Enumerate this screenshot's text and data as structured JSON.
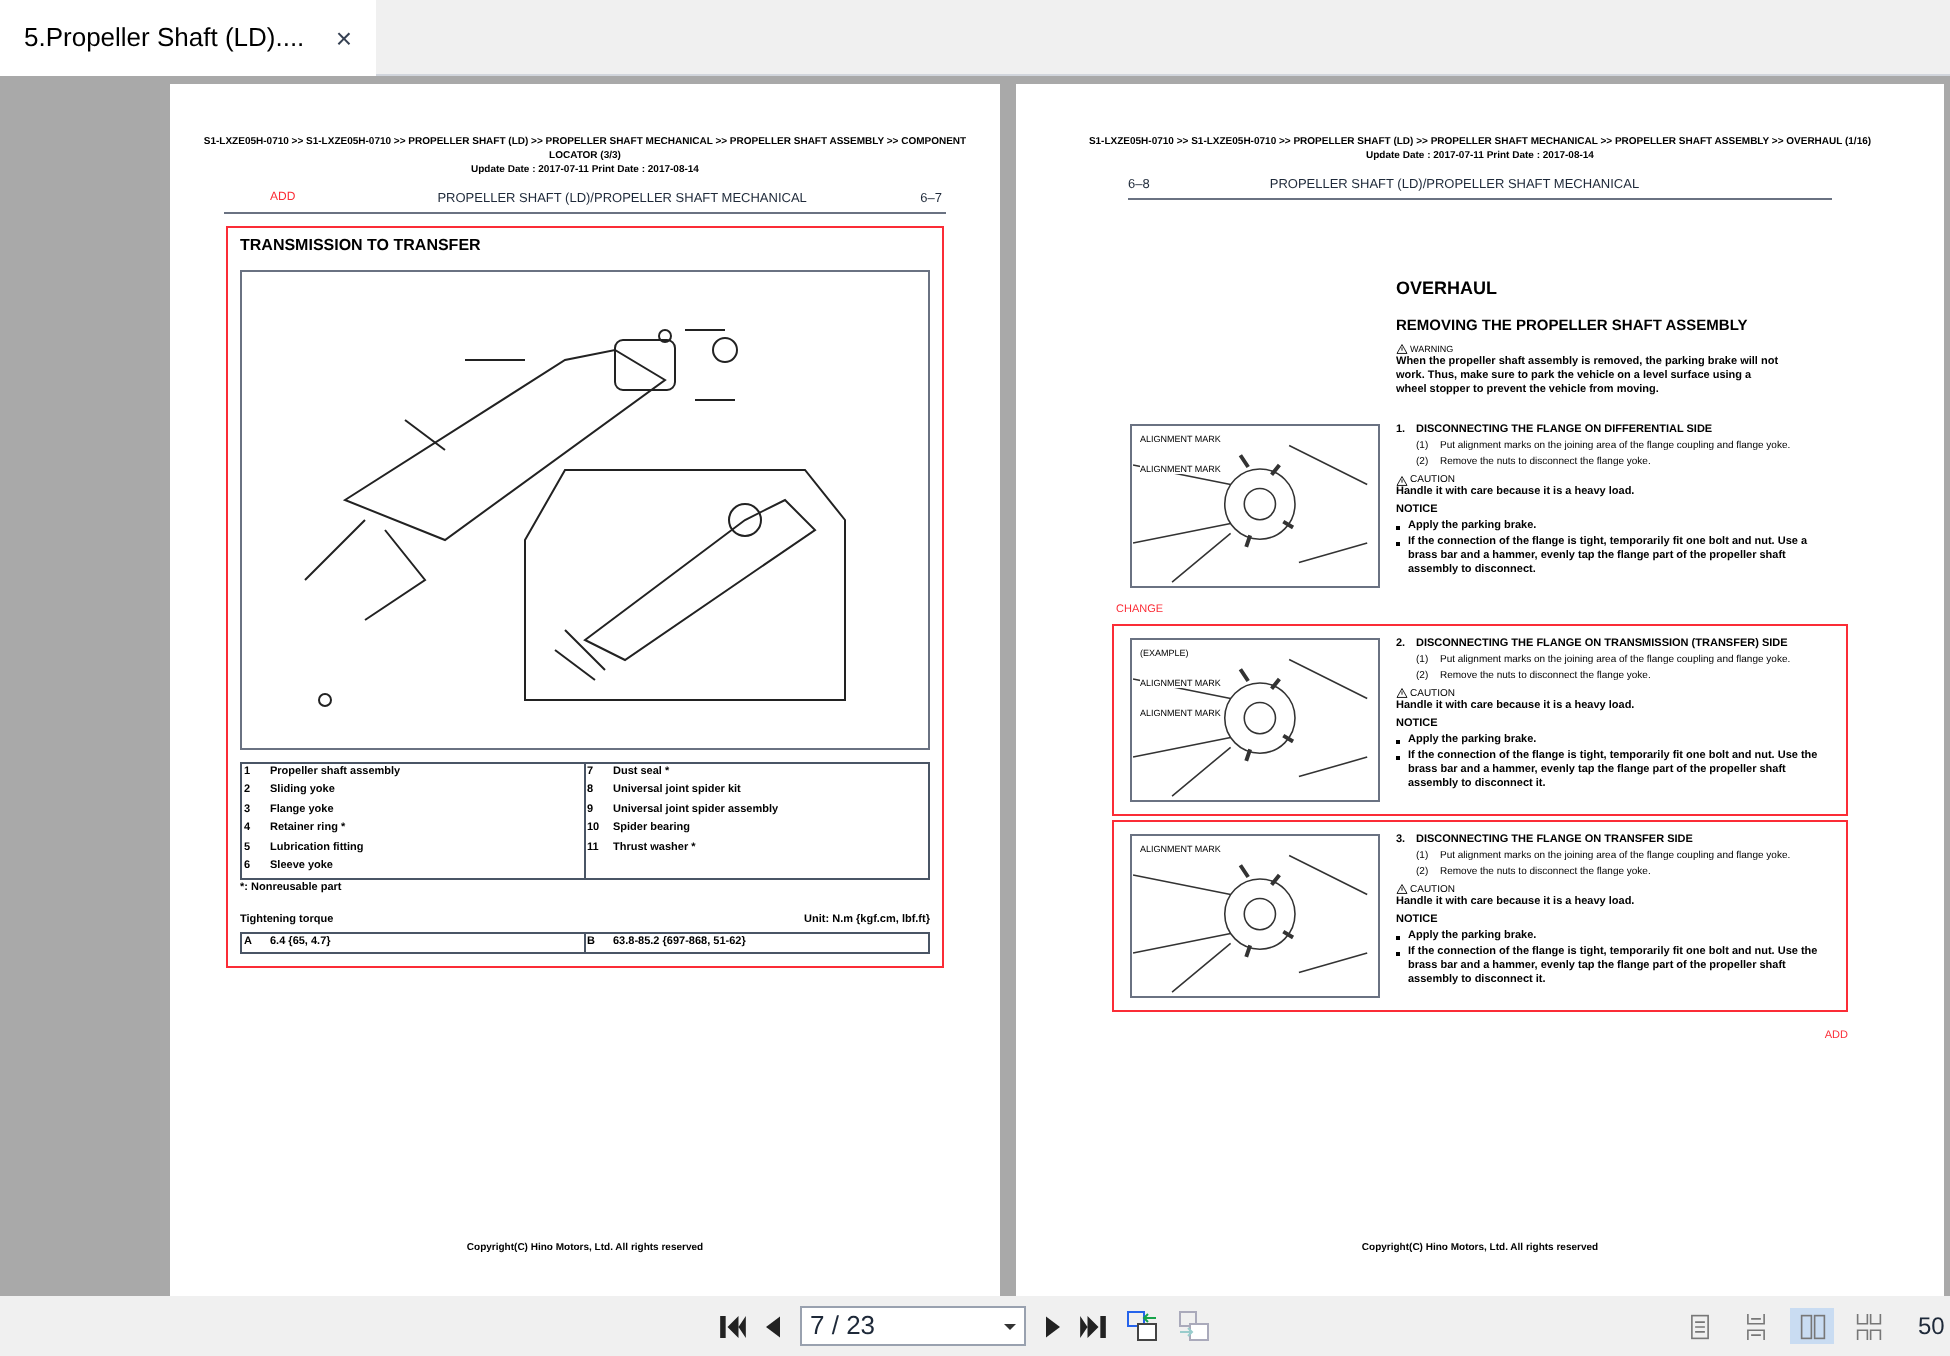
{
  "tab": {
    "title": "5.Propeller Shaft (LD)....",
    "close": "×",
    "selected": true
  },
  "left_page": {
    "breadcrumb": "S1-LXZE05H-0710 >> S1-LXZE05H-0710 >> PROPELLER SHAFT (LD) >> PROPELLER SHAFT MECHANICAL >> PROPELLER SHAFT ASSEMBLY >> COMPONENT LOCATOR (3/3)",
    "dates": "Update Date : 2017-07-11   Print Date : 2017-08-14",
    "mark": "ADD",
    "header_title": "PROPELLER SHAFT (LD)/PROPELLER SHAFT MECHANICAL",
    "page_number": "6–7",
    "section_title": "TRANSMISSION TO TRANSFER",
    "parts": [
      {
        "number": "1",
        "name": "Propeller shaft assembly"
      },
      {
        "number": "2",
        "name": "Sliding yoke"
      },
      {
        "number": "3",
        "name": "Flange yoke"
      },
      {
        "number": "4",
        "name": "Retainer ring *"
      },
      {
        "number": "5",
        "name": "Lubrication fitting"
      },
      {
        "number": "6",
        "name": "Sleeve yoke"
      },
      {
        "number": "7",
        "name": "Dust seal *"
      },
      {
        "number": "8",
        "name": "Universal joint spider kit"
      },
      {
        "number": "9",
        "name": "Universal joint spider assembly"
      },
      {
        "number": "10",
        "name": "Spider bearing"
      },
      {
        "number": "11",
        "name": "Thrust washer *"
      }
    ],
    "note": "*: Nonreusable part",
    "torque_title": "Tightening torque",
    "torque_unit": "Unit: N.m {kgf.cm, lbf.ft}",
    "torques": [
      {
        "key": "A",
        "value": "6.4 {65, 4.7}"
      },
      {
        "key": "B",
        "value": "63.8-85.2 {697-868, 51-62}"
      }
    ],
    "copyright": "Copyright(C) Hino Motors, Ltd. All rights reserved"
  },
  "right_page": {
    "breadcrumb": "S1-LXZE05H-0710 >> S1-LXZE05H-0710 >> PROPELLER SHAFT (LD) >> PROPELLER SHAFT MECHANICAL >> PROPELLER SHAFT ASSEMBLY >> OVERHAUL (1/16)",
    "dates": "Update Date : 2017-07-11   Print Date : 2017-08-14",
    "page_number": "6–8",
    "header_title": "PROPELLER SHAFT (LD)/PROPELLER SHAFT MECHANICAL",
    "heading": "OVERHAUL",
    "subheading": "REMOVING THE PROPELLER SHAFT ASSEMBLY",
    "warning_label": "WARNING",
    "warning_text": "When the propeller shaft assembly is removed, the parking brake will not work. Thus, make sure to park the vehicle on a level surface using a wheel stopper to prevent the vehicle from moving.",
    "steps": [
      {
        "number": "1.",
        "title": "DISCONNECTING THE FLANGE ON DIFFERENTIAL SIDE",
        "highlighted": false,
        "mark": "CHANGE",
        "figure_labels": [
          "ALIGNMENT MARK",
          "ALIGNMENT MARK"
        ],
        "substeps": [
          {
            "number": "(1)",
            "text": "Put alignment marks on the joining area of the flange coupling and flange yoke."
          },
          {
            "number": "(2)",
            "text": "Remove the nuts to disconnect the flange yoke."
          }
        ],
        "caution_label": "CAUTION",
        "caution_text": "Handle it with care because it is a heavy load.",
        "notice_label": "NOTICE",
        "notices": [
          "Apply the parking brake.",
          "If the connection of the flange is tight, temporarily fit one bolt and nut. Use a brass bar and a hammer, evenly tap the flange part of the propeller shaft assembly to disconnect."
        ]
      },
      {
        "number": "2.",
        "title": "DISCONNECTING THE FLANGE ON TRANSMISSION (TRANSFER) SIDE",
        "highlighted": true,
        "figure_labels": [
          "(EXAMPLE)",
          "ALIGNMENT MARK",
          "ALIGNMENT MARK"
        ],
        "substeps": [
          {
            "number": "(1)",
            "text": "Put alignment marks on the joining area of the flange coupling and flange yoke."
          },
          {
            "number": "(2)",
            "text": "Remove the nuts to disconnect the flange yoke."
          }
        ],
        "caution_label": "CAUTION",
        "caution_text": "Handle it with care because it is a heavy load.",
        "notice_label": "NOTICE",
        "notices": [
          "Apply the parking brake.",
          "If the connection of the flange is tight, temporarily fit one bolt and nut. Use the brass bar and a hammer, evenly tap the flange part of the propeller shaft assembly to disconnect it."
        ]
      },
      {
        "number": "3.",
        "title": "DISCONNECTING THE FLANGE ON TRANSFER SIDE",
        "highlighted": true,
        "figure_labels": [
          "ALIGNMENT MARK"
        ],
        "substeps": [
          {
            "number": "(1)",
            "text": "Put alignment marks on the joining area of the flange coupling and flange yoke."
          },
          {
            "number": "(2)",
            "text": "Remove the nuts to disconnect the flange yoke."
          }
        ],
        "caution_label": "CAUTION",
        "caution_text": "Handle it with care because it is a heavy load.",
        "notice_label": "NOTICE",
        "notices": [
          "Apply the parking brake.",
          "If the connection of the flange is tight, temporarily fit one bolt and nut. Use the brass bar and a hammer, evenly tap the flange part of the propeller shaft assembly to disconnect it."
        ]
      }
    ],
    "end_mark": "ADD",
    "copyright": "Copyright(C) Hino Motors, Ltd. All rights reserved"
  },
  "toolbar": {
    "page_field": "7 / 23",
    "zoom": "50",
    "view_modes": [
      {
        "kind": "single",
        "selected": false
      },
      {
        "kind": "continuous",
        "selected": false
      },
      {
        "kind": "facing",
        "selected": true
      },
      {
        "kind": "facing-continuous",
        "selected": false
      }
    ]
  }
}
